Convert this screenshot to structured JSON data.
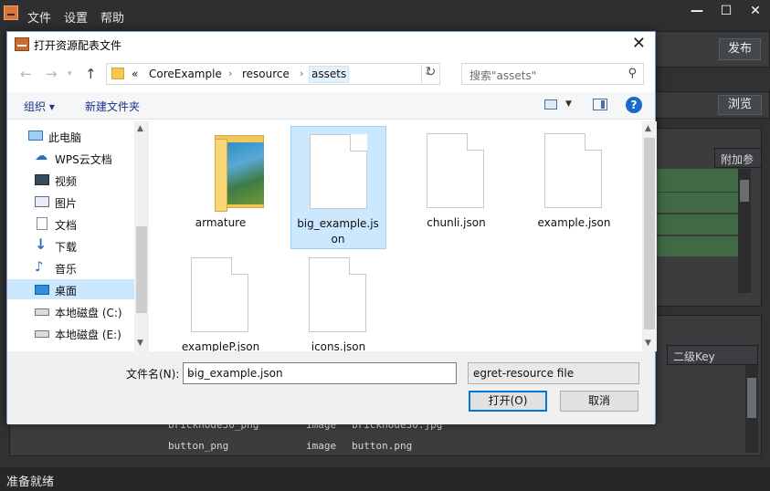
{
  "app": {
    "menu": [
      "文件",
      "设置",
      "帮助"
    ],
    "publish_label": "发布",
    "browse_label": "浏览",
    "column_extra": "附加参",
    "column_key2": "二级Key",
    "rows": [
      {
        "name": "bricknode30_png",
        "type": "image",
        "url": "bricknode30.jpg"
      },
      {
        "name": "button_png",
        "type": "image",
        "url": "button.png"
      }
    ],
    "status": "准备就绪"
  },
  "dialog": {
    "title": "打开资源配表文件",
    "breadcrumb_prefix": "«",
    "breadcrumb": [
      "CoreExample",
      "resource",
      "assets"
    ],
    "search_placeholder": "搜索\"assets\"",
    "toolbar": {
      "organize": "组织 ▾",
      "new_folder": "新建文件夹"
    },
    "nav_items": [
      {
        "label": "此电脑",
        "icon": "computer-icon"
      },
      {
        "label": "WPS云文档",
        "icon": "cloud-icon"
      },
      {
        "label": "视频",
        "icon": "video-icon"
      },
      {
        "label": "图片",
        "icon": "pictures-icon"
      },
      {
        "label": "文档",
        "icon": "documents-icon"
      },
      {
        "label": "下载",
        "icon": "download-icon"
      },
      {
        "label": "音乐",
        "icon": "music-icon"
      },
      {
        "label": "桌面",
        "icon": "desktop-icon",
        "selected": true
      },
      {
        "label": "本地磁盘 (C:)",
        "icon": "drive-icon"
      },
      {
        "label": "本地磁盘 (E:)",
        "icon": "drive-icon"
      }
    ],
    "files": [
      {
        "name": "armature",
        "kind": "folder"
      },
      {
        "name": "big_example.json",
        "kind": "file",
        "selected": true
      },
      {
        "name": "chunli.json",
        "kind": "file"
      },
      {
        "name": "example.json",
        "kind": "file"
      },
      {
        "name": "exampleP.json",
        "kind": "file"
      },
      {
        "name": "icons.json",
        "kind": "file"
      }
    ],
    "filename_label": "文件名(N):",
    "filename_value": "big_example.json",
    "filetype_value": "egret-resource file",
    "open_label": "打开(O)",
    "cancel_label": "取消"
  }
}
